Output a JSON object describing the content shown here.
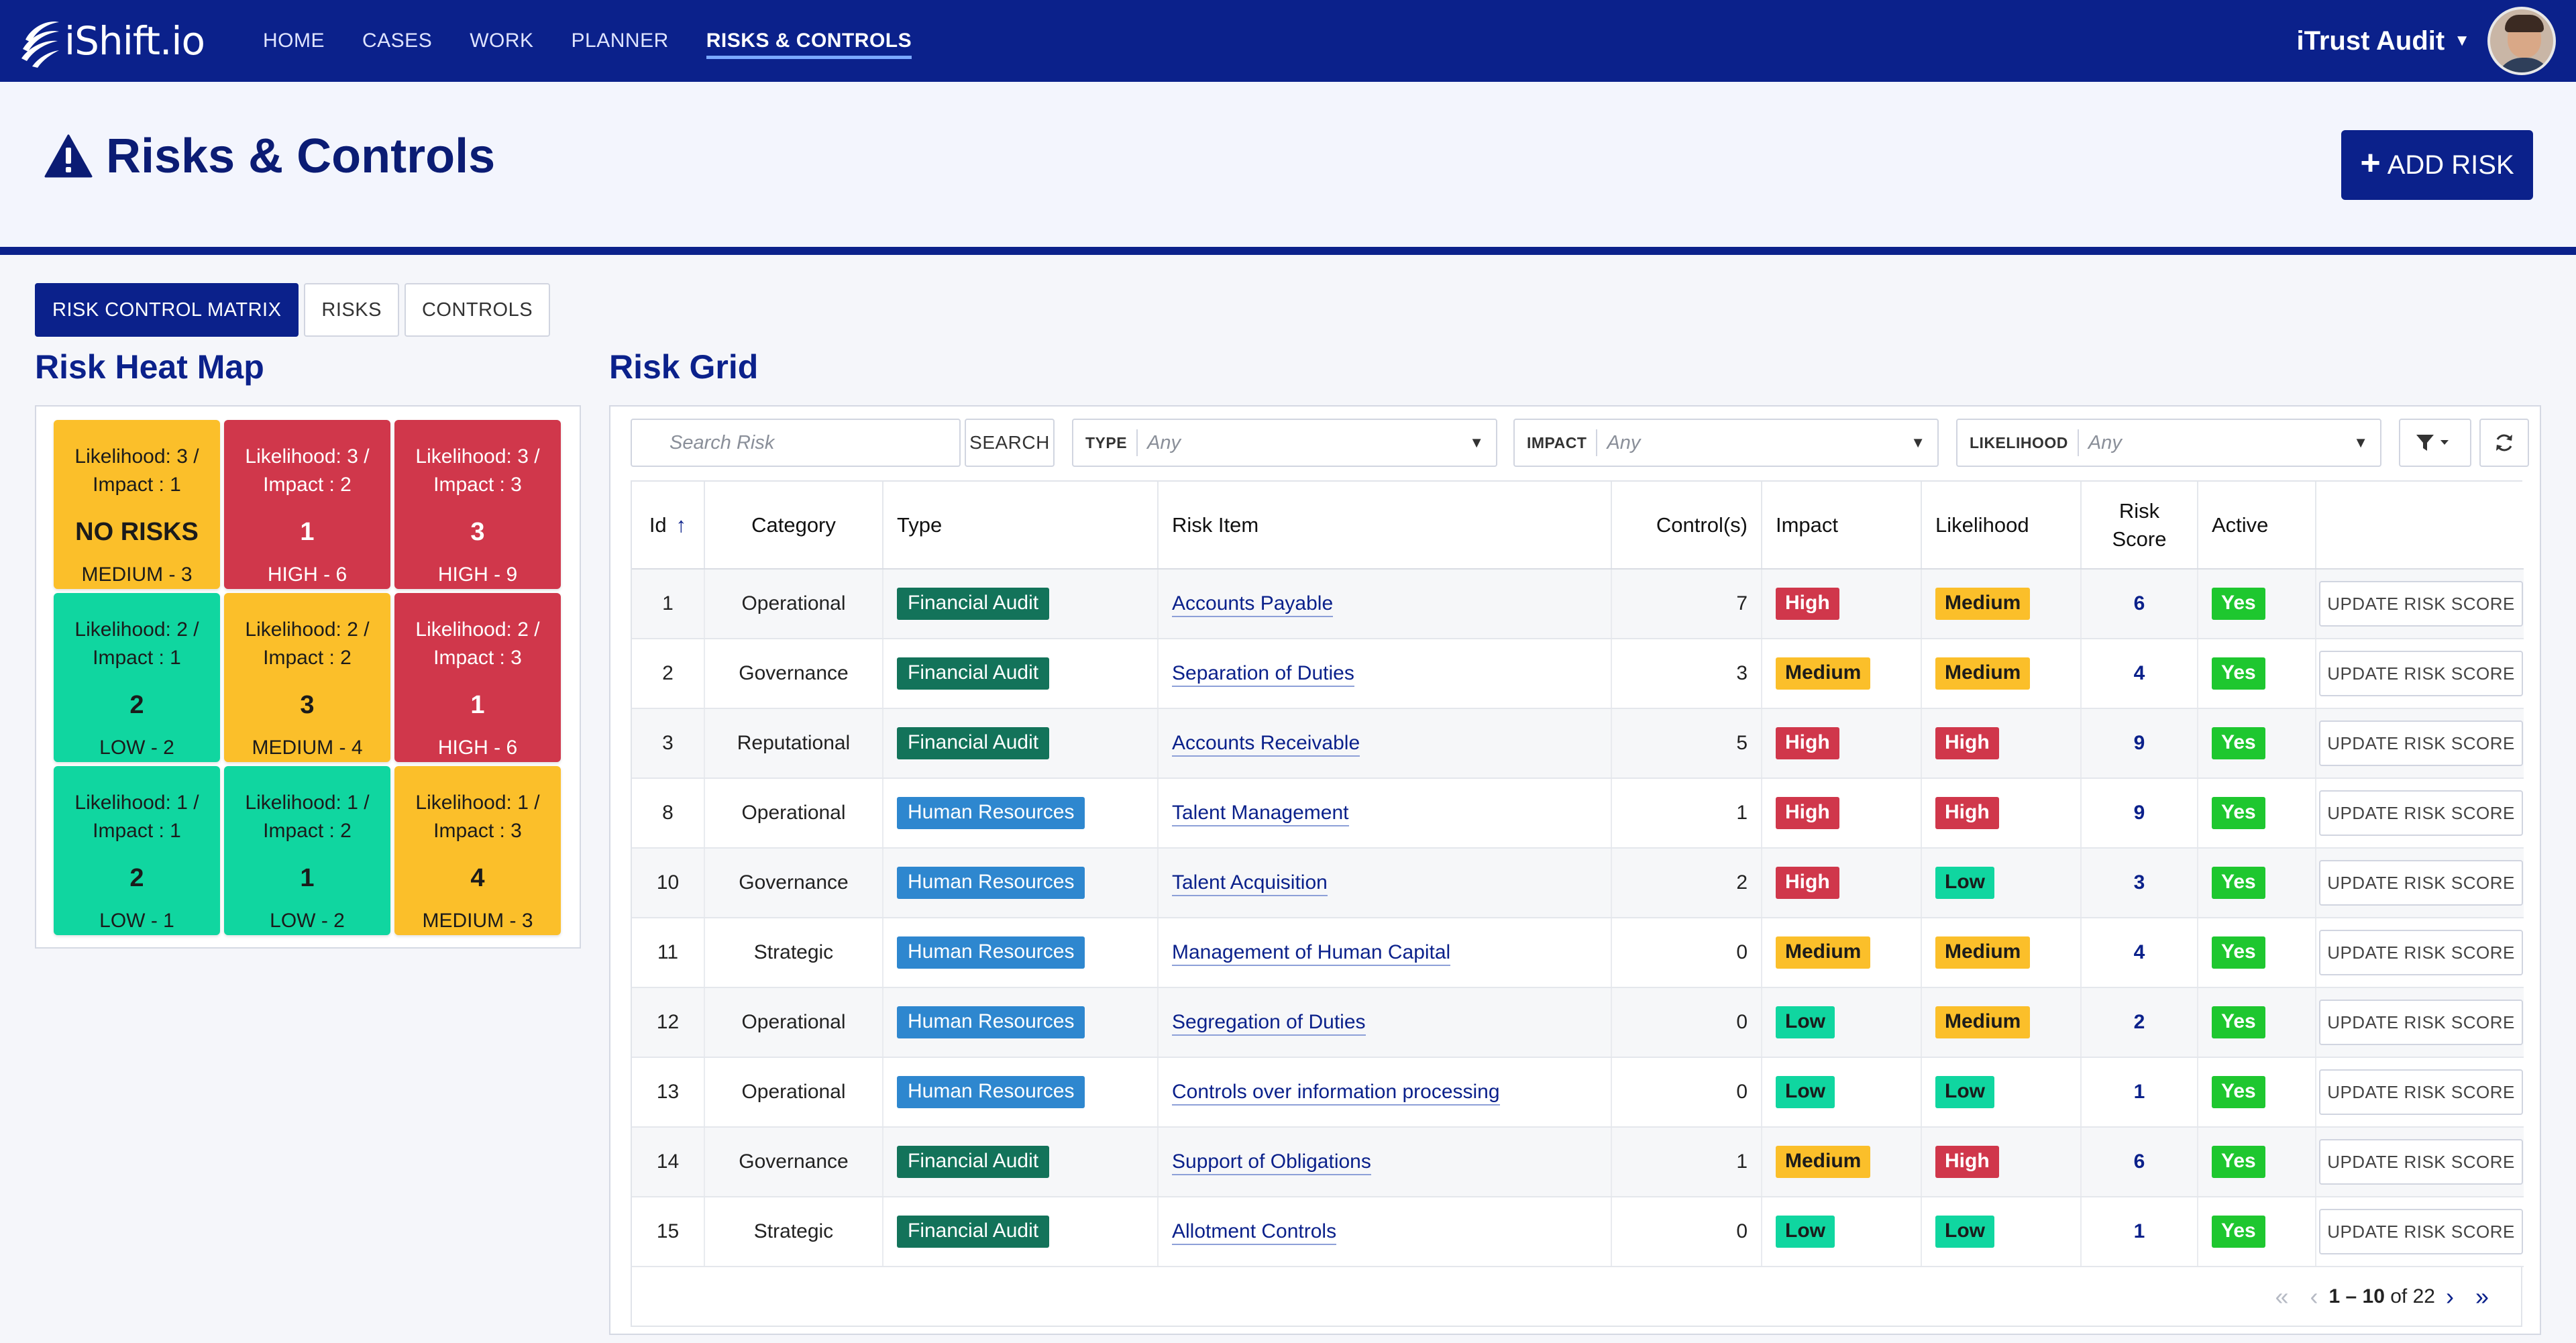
{
  "brand": {
    "name": "iShift.io"
  },
  "nav": {
    "items": [
      {
        "label": "HOME"
      },
      {
        "label": "CASES"
      },
      {
        "label": "WORK"
      },
      {
        "label": "PLANNER"
      },
      {
        "label": "RISKS & CONTROLS",
        "active": true
      }
    ],
    "user": {
      "name": "iTrust Audit",
      "icon": "chevron-down-icon"
    }
  },
  "header": {
    "title": "Risks & Controls",
    "icon": "warning-triangle-icon",
    "add_button": "ADD RISK"
  },
  "tabs": [
    {
      "label": "RISK CONTROL MATRIX",
      "active": true
    },
    {
      "label": "RISKS"
    },
    {
      "label": "CONTROLS"
    }
  ],
  "heatmap": {
    "title": "Risk Heat Map",
    "colors": {
      "red": "#d0374b",
      "amber": "#fbbf2a",
      "green": "#10d6a0"
    },
    "cells": [
      {
        "line1": "Likelihood: 3 /",
        "line2": "Impact : 1",
        "count": "NO RISKS",
        "level": "MEDIUM - 3",
        "color": "amber"
      },
      {
        "line1": "Likelihood: 3 /",
        "line2": "Impact : 2",
        "count": "1",
        "level": "HIGH - 6",
        "color": "red"
      },
      {
        "line1": "Likelihood: 3 /",
        "line2": "Impact : 3",
        "count": "3",
        "level": "HIGH - 9",
        "color": "red"
      },
      {
        "line1": "Likelihood: 2 /",
        "line2": "Impact : 1",
        "count": "2",
        "level": "LOW - 2",
        "color": "green"
      },
      {
        "line1": "Likelihood: 2 /",
        "line2": "Impact : 2",
        "count": "3",
        "level": "MEDIUM - 4",
        "color": "amber"
      },
      {
        "line1": "Likelihood: 2 /",
        "line2": "Impact : 3",
        "count": "1",
        "level": "HIGH - 6",
        "color": "red"
      },
      {
        "line1": "Likelihood: 1 /",
        "line2": "Impact : 1",
        "count": "2",
        "level": "LOW - 1",
        "color": "green"
      },
      {
        "line1": "Likelihood: 1 /",
        "line2": "Impact : 2",
        "count": "1",
        "level": "LOW - 2",
        "color": "green"
      },
      {
        "line1": "Likelihood: 1 /",
        "line2": "Impact : 3",
        "count": "4",
        "level": "MEDIUM - 3",
        "color": "amber"
      }
    ]
  },
  "grid": {
    "title": "Risk Grid",
    "search": {
      "placeholder": "Search Risk",
      "button": "SEARCH"
    },
    "filters": [
      {
        "label": "TYPE",
        "value": "Any"
      },
      {
        "label": "IMPACT",
        "value": "Any"
      },
      {
        "label": "LIKELIHOOD",
        "value": "Any"
      }
    ],
    "columns": {
      "id": "Id",
      "category": "Category",
      "type": "Type",
      "risk_item": "Risk Item",
      "controls": "Control(s)",
      "impact": "Impact",
      "likelihood": "Likelihood",
      "risk_score_1": "Risk",
      "risk_score_2": "Score",
      "active": "Active"
    },
    "type_colors": {
      "Financial Audit": "#13735a",
      "Human Resources": "#2e87cf"
    },
    "level_colors": {
      "High": {
        "bg": "#d0374b",
        "fg": "#ffffff"
      },
      "Medium": {
        "bg": "#fbbf2a",
        "fg": "#1b1b1b"
      },
      "Low": {
        "bg": "#10d6a0",
        "fg": "#1b1b1b"
      }
    },
    "active_color": "#1ec72f",
    "update_label": "UPDATE RISK SCORE",
    "rows": [
      {
        "id": "1",
        "category": "Operational",
        "type": "Financial Audit",
        "risk_item": "Accounts Payable",
        "controls": "7",
        "impact": "High",
        "likelihood": "Medium",
        "score": "6",
        "active": "Yes"
      },
      {
        "id": "2",
        "category": "Governance",
        "type": "Financial Audit",
        "risk_item": "Separation of Duties",
        "controls": "3",
        "impact": "Medium",
        "likelihood": "Medium",
        "score": "4",
        "active": "Yes"
      },
      {
        "id": "3",
        "category": "Reputational",
        "type": "Financial Audit",
        "risk_item": "Accounts Receivable",
        "controls": "5",
        "impact": "High",
        "likelihood": "High",
        "score": "9",
        "active": "Yes"
      },
      {
        "id": "8",
        "category": "Operational",
        "type": "Human Resources",
        "risk_item": "Talent Management",
        "controls": "1",
        "impact": "High",
        "likelihood": "High",
        "score": "9",
        "active": "Yes"
      },
      {
        "id": "10",
        "category": "Governance",
        "type": "Human Resources",
        "risk_item": "Talent Acquisition",
        "controls": "2",
        "impact": "High",
        "likelihood": "Low",
        "score": "3",
        "active": "Yes"
      },
      {
        "id": "11",
        "category": "Strategic",
        "type": "Human Resources",
        "risk_item": "Management of Human Capital",
        "controls": "0",
        "impact": "Medium",
        "likelihood": "Medium",
        "score": "4",
        "active": "Yes"
      },
      {
        "id": "12",
        "category": "Operational",
        "type": "Human Resources",
        "risk_item": "Segregation of Duties",
        "controls": "0",
        "impact": "Low",
        "likelihood": "Medium",
        "score": "2",
        "active": "Yes"
      },
      {
        "id": "13",
        "category": "Operational",
        "type": "Human Resources",
        "risk_item": "Controls over information processing",
        "controls": "0",
        "impact": "Low",
        "likelihood": "Low",
        "score": "1",
        "active": "Yes"
      },
      {
        "id": "14",
        "category": "Governance",
        "type": "Financial Audit",
        "risk_item": "Support of Obligations",
        "controls": "1",
        "impact": "Medium",
        "likelihood": "High",
        "score": "6",
        "active": "Yes"
      },
      {
        "id": "15",
        "category": "Strategic",
        "type": "Financial Audit",
        "risk_item": "Allotment Controls",
        "controls": "0",
        "impact": "Low",
        "likelihood": "Low",
        "score": "1",
        "active": "Yes"
      }
    ],
    "pagination": {
      "range": "1 – 10",
      "of": "of 22"
    }
  }
}
